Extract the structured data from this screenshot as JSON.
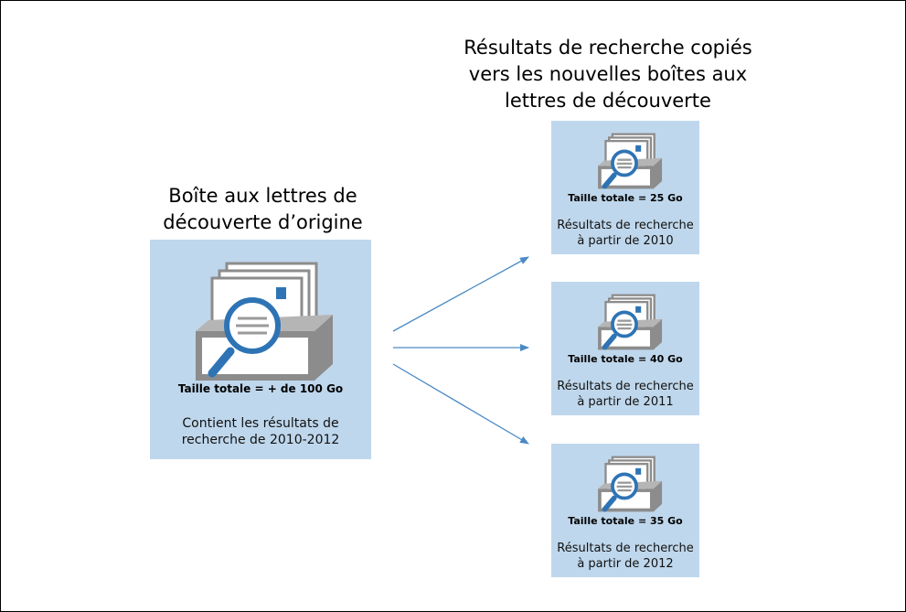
{
  "source": {
    "heading_line1": "Boîte aux lettres de",
    "heading_line2": "découverte d’origine",
    "size": "Taille totale = + de 100 Go",
    "desc_line1": "Contient les résultats de",
    "desc_line2": "recherche de 2010-2012"
  },
  "destination_heading": {
    "line1": "Résultats de recherche copiés",
    "line2": "vers les nouvelles boîtes aux",
    "line3": "lettres de découverte"
  },
  "destinations": [
    {
      "size": "Taille totale = 25 Go",
      "desc_line1": "Résultats de recherche",
      "desc_line2": "à partir de 2010"
    },
    {
      "size": "Taille totale = 40 Go",
      "desc_line1": "Résultats de recherche",
      "desc_line2": "à partir de 2011"
    },
    {
      "size": "Taille totale = 35 Go",
      "desc_line1": "Résultats de recherche",
      "desc_line2": "à partir de 2012"
    }
  ],
  "colors": {
    "box_fill": "#bfd7ec",
    "arrow": "#4a8ac4",
    "magnifier": "#2e74b5",
    "stamp": "#2e74b5",
    "tray_gray": "#8c8c8c"
  },
  "icons": [
    "mailbox-search-icon"
  ]
}
